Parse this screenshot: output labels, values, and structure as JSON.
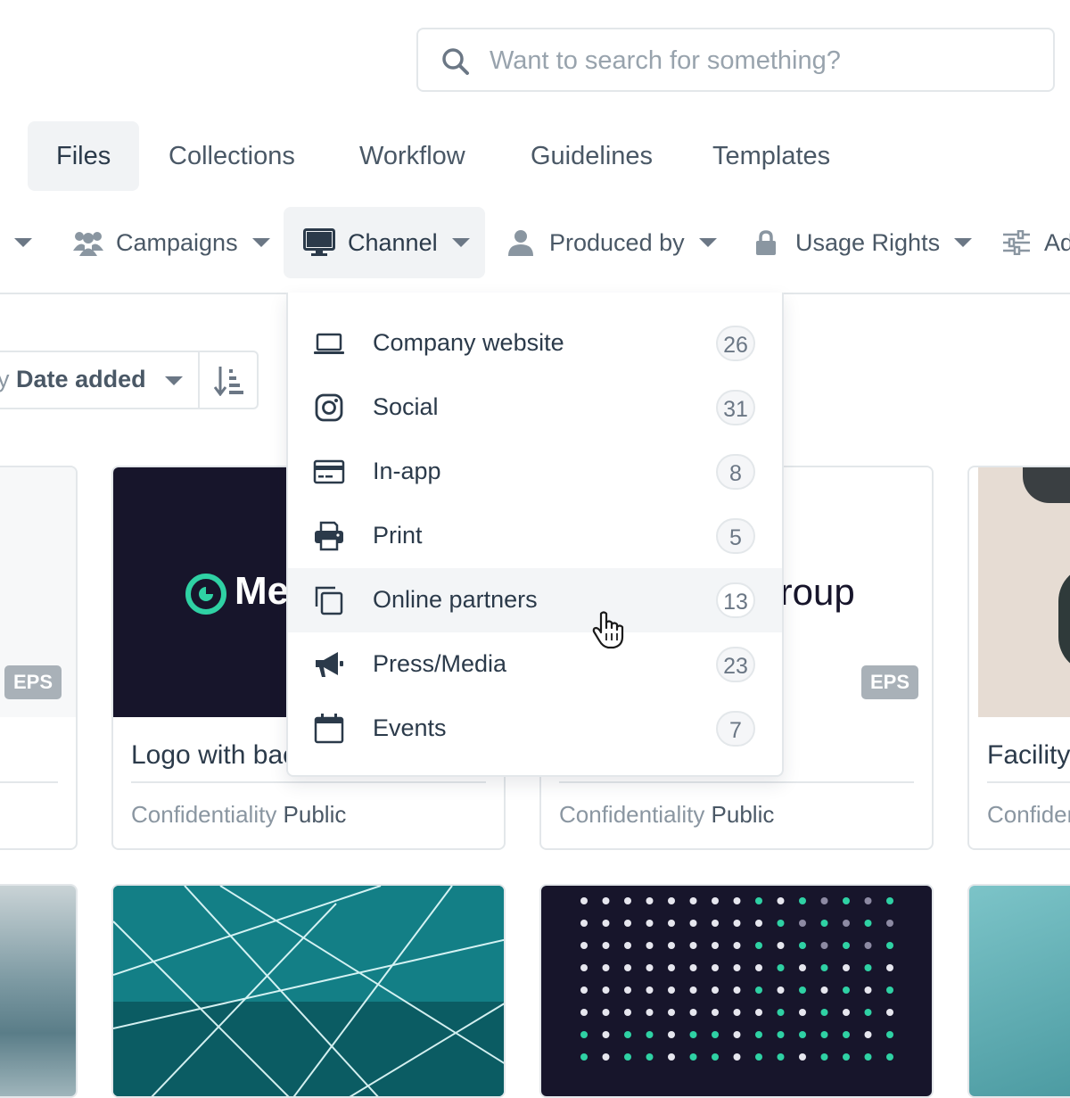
{
  "search": {
    "placeholder": "Want to search for something?"
  },
  "tabs": [
    {
      "label": "Files",
      "active": true
    },
    {
      "label": "Collections"
    },
    {
      "label": "Workflow"
    },
    {
      "label": "Guidelines"
    },
    {
      "label": "Templates"
    }
  ],
  "filters": {
    "campaigns": "Campaigns",
    "channel": "Channel",
    "produced_by": "Produced by",
    "usage_rights": "Usage Rights",
    "advanced_partial": "Ad"
  },
  "sort": {
    "label_partial": "by",
    "value": "Date added"
  },
  "channel_menu": [
    {
      "label": "Company website",
      "count": "26",
      "icon": "laptop-icon"
    },
    {
      "label": "Social",
      "count": "31",
      "icon": "instagram-icon"
    },
    {
      "label": "In-app",
      "count": "8",
      "icon": "credit-card-icon"
    },
    {
      "label": "Print",
      "count": "5",
      "icon": "printer-icon"
    },
    {
      "label": "Online partners",
      "count": "13",
      "icon": "copy-icon",
      "hovered": true
    },
    {
      "label": "Press/Media",
      "count": "23",
      "icon": "megaphone-icon"
    },
    {
      "label": "Events",
      "count": "7",
      "icon": "calendar-icon"
    }
  ],
  "cards": [
    {
      "badge": "EPS"
    },
    {
      "logo_text": "Me",
      "title": "Logo with bac",
      "meta_key": "Confidentiality",
      "meta_value": "Public"
    },
    {
      "logo_text": "Group",
      "badge": "EPS",
      "meta_key": "Confidentiality",
      "meta_value": "Public"
    },
    {
      "title": "Facility",
      "meta_key": "Confiden"
    }
  ],
  "colors": {
    "accent": "#2fd1a4",
    "dark": "#17152b",
    "border": "#e3e7ea"
  }
}
